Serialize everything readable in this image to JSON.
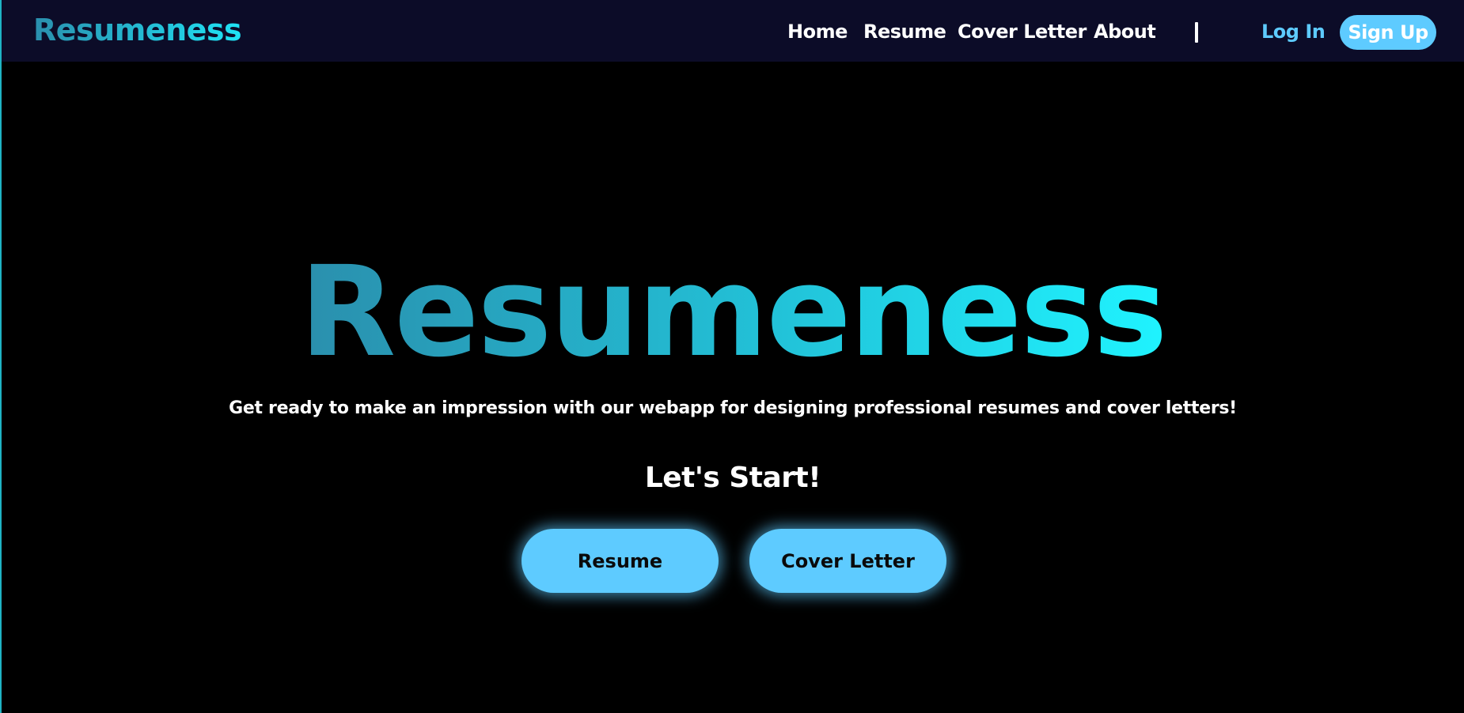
{
  "brand": {
    "name": "Resumeness"
  },
  "nav": {
    "links": [
      "Home",
      "Resume",
      "Cover Letter",
      "About"
    ],
    "divider": "|",
    "login_label": "Log In",
    "signup_label": "Sign Up"
  },
  "hero": {
    "title": "Resumeness",
    "subtitle": "Get ready to make an impression with our webapp for designing professional resumes and cover letters!",
    "start_heading": "Let's Start!",
    "buttons": [
      "Resume",
      "Cover Letter"
    ]
  },
  "colors": {
    "navbar_bg": "#0c0c28",
    "page_bg": "#000000",
    "accent": "#5ecbff",
    "gradient_start": "#2a8fad",
    "gradient_end": "#1ff3ff"
  }
}
